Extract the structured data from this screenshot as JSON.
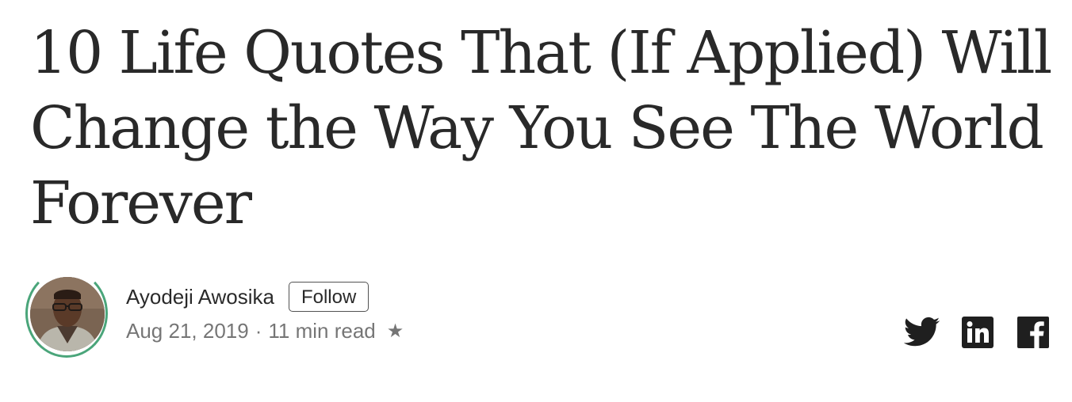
{
  "article": {
    "title": "10 Life Quotes That (If Applied) Will Change the Way You See The World Forever"
  },
  "author": {
    "name": "Ayodeji Awosika",
    "follow_label": "Follow",
    "ring_color": "#4aa57a"
  },
  "meta": {
    "date": "Aug 21, 2019",
    "separator": "·",
    "read_time": "11 min read",
    "star": "★"
  },
  "share": {
    "icons": [
      "twitter-icon",
      "linkedin-icon",
      "facebook-icon"
    ]
  }
}
